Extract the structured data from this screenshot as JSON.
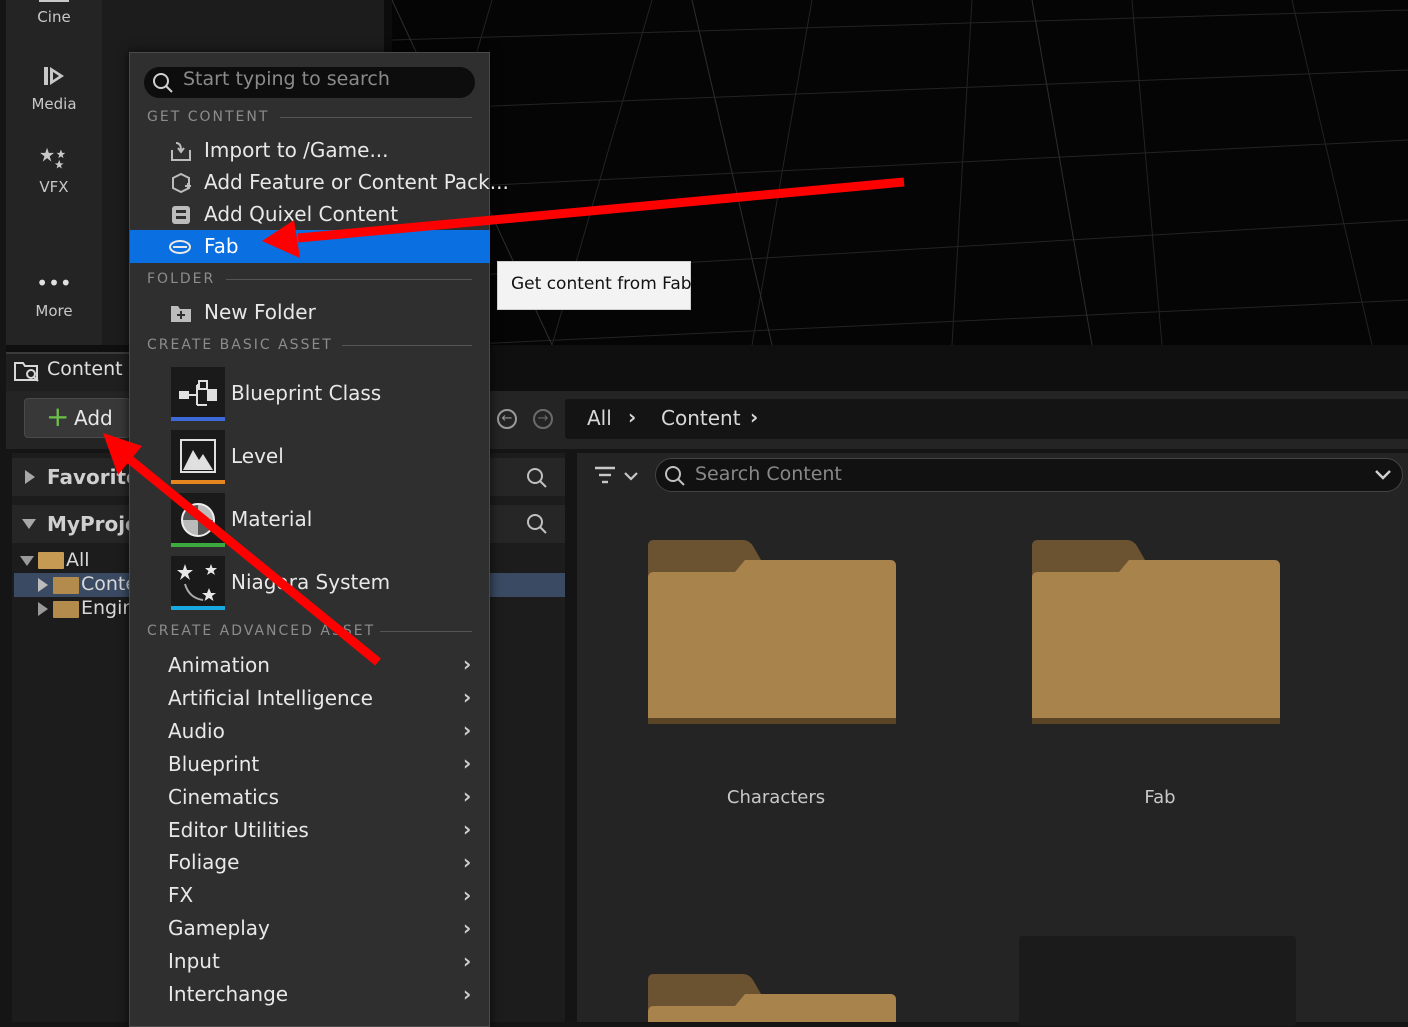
{
  "toolbar_left": {
    "items": [
      {
        "label": "Cine",
        "icon": "cine-icon"
      },
      {
        "label": "Media",
        "icon": "media-icon"
      },
      {
        "label": "VFX",
        "icon": "vfx-icon"
      },
      {
        "label": "More",
        "icon": "more-dots-icon"
      }
    ]
  },
  "content_browser": {
    "tab_label": "Content E",
    "add_label": "Add",
    "breadcrumbs": [
      "All",
      "Content"
    ],
    "sources": {
      "favorites": "Favorites",
      "project": "MyProjec",
      "tree": [
        "All",
        "Conte",
        "Engin"
      ]
    },
    "search_placeholder": "Search Content",
    "folders": [
      "Characters",
      "Fab"
    ]
  },
  "add_menu": {
    "search_placeholder": "Start typing to search",
    "sections": {
      "get_content": "GET CONTENT",
      "folder": "FOLDER",
      "create_basic": "CREATE BASIC ASSET",
      "create_advanced": "CREATE ADVANCED ASSET"
    },
    "get_content_items": [
      "Import to /Game...",
      "Add Feature or Content Pack...",
      "Add Quixel Content",
      "Fab"
    ],
    "folder_items": [
      "New Folder"
    ],
    "basic_assets": [
      {
        "label": "Blueprint Class",
        "color": "#3d6ad8"
      },
      {
        "label": "Level",
        "color": "#e6861e"
      },
      {
        "label": "Material",
        "color": "#3caa3c"
      },
      {
        "label": "Niagara System",
        "color": "#19a8e0"
      }
    ],
    "advanced_assets": [
      "Animation",
      "Artificial Intelligence",
      "Audio",
      "Blueprint",
      "Cinematics",
      "Editor Utilities",
      "Foliage",
      "FX",
      "Gameplay",
      "Input",
      "Interchange"
    ]
  },
  "tooltip": "Get content from Fab",
  "colors": {
    "highlight": "#0a6fe0",
    "annotation_arrow": "#ff0000",
    "folder": "#b38b4c"
  }
}
